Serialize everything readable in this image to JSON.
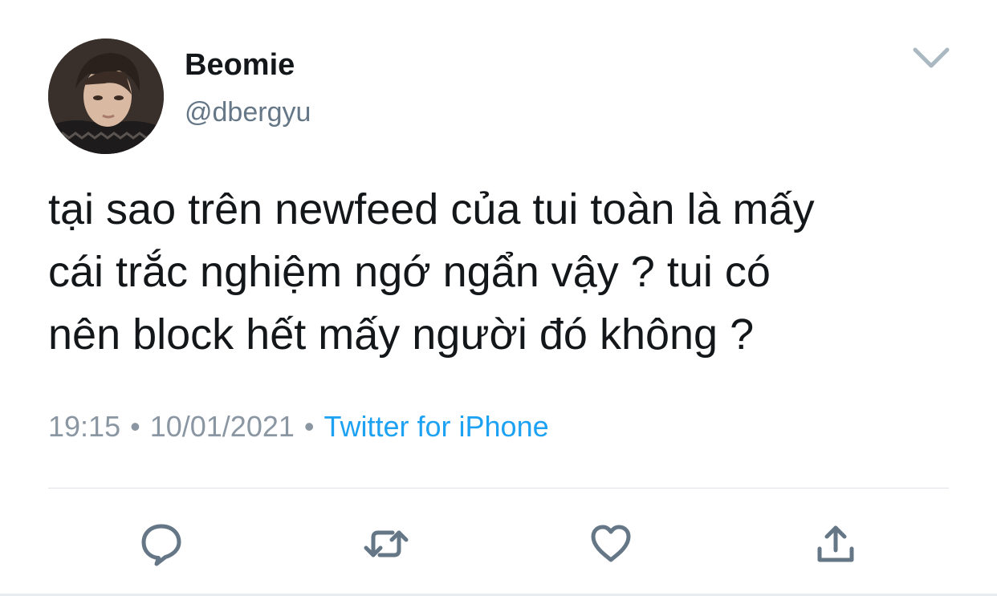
{
  "user": {
    "display_name": "Beomie",
    "handle": "@dbergyu",
    "avatar_icon": "profile-photo"
  },
  "tweet": {
    "text": "tại sao trên newfeed của tui toàn là mấy\ncái trắc nghiệm ngớ ngẩn vậy ? tui có\nnên block hết mấy người đó không ?",
    "time": "19:15",
    "separator": "•",
    "date": "10/01/2021",
    "source": "Twitter for iPhone"
  },
  "actions": [
    {
      "icon": "reply-icon"
    },
    {
      "icon": "retweet-icon"
    },
    {
      "icon": "like-icon"
    },
    {
      "icon": "share-icon"
    }
  ],
  "colors": {
    "text": "#14171a",
    "secondary": "#657786",
    "link": "#1da1f2",
    "icon": "#657786",
    "divider": "#dfe3e7"
  }
}
